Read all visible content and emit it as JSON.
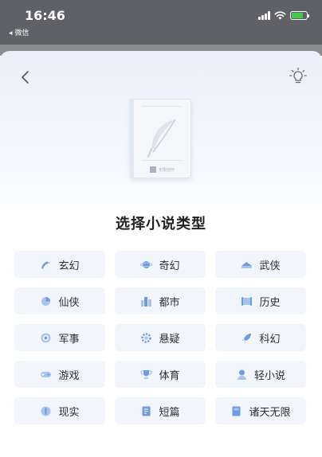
{
  "status_bar": {
    "time": "16:46",
    "back_app": "◂ 微信"
  },
  "header": {
    "back_icon": "chevron-left-icon",
    "tip_icon": "lightbulb-icon"
  },
  "cover": {
    "brand_text": "无限创作"
  },
  "title": "选择小说类型",
  "colors": {
    "accent": "#5b8fe0",
    "chip_bg": "#f2f6fc",
    "sheet_top": "#e9f0fb"
  },
  "genres": [
    {
      "label": "玄幻",
      "icon": "dragon-icon"
    },
    {
      "label": "奇幻",
      "icon": "planet-icon"
    },
    {
      "label": "武侠",
      "icon": "hat-icon"
    },
    {
      "label": "仙侠",
      "icon": "cloud-icon"
    },
    {
      "label": "都市",
      "icon": "city-icon"
    },
    {
      "label": "历史",
      "icon": "scroll-icon"
    },
    {
      "label": "军事",
      "icon": "target-icon"
    },
    {
      "label": "悬疑",
      "icon": "gear-icon"
    },
    {
      "label": "科幻",
      "icon": "rocket-icon"
    },
    {
      "label": "游戏",
      "icon": "gamepad-icon"
    },
    {
      "label": "体育",
      "icon": "trophy-icon"
    },
    {
      "label": "轻小说",
      "icon": "character-icon"
    },
    {
      "label": "现实",
      "icon": "people-icon"
    },
    {
      "label": "短篇",
      "icon": "document-icon"
    },
    {
      "label": "诸天无限",
      "icon": "book-icon"
    }
  ]
}
